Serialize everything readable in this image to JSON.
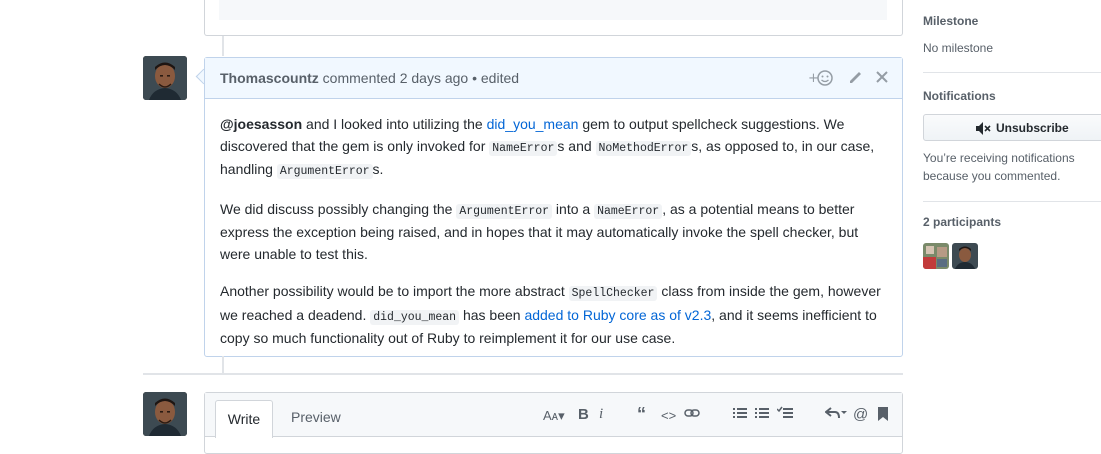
{
  "comment": {
    "author": "Thomascountz",
    "header_rest": "commented 2 days ago • edited",
    "p1": {
      "mention": "@joesasson",
      "t1": " and I looked into utilizing the ",
      "link1": "did_you_mean",
      "t2": " gem to output spellcheck suggestions. We discovered that the gem is only invoked for ",
      "c1": "NameError",
      "t3": "s and ",
      "c2": "NoMethodError",
      "t4": "s, as opposed to, in our case, handling ",
      "c3": "ArgumentError",
      "t5": "s."
    },
    "p2": {
      "t1": "We did discuss possibly changing the ",
      "c1": "ArgumentError",
      "t2": " into a ",
      "c2": "NameError",
      "t3": ", as a potential means to better express the exception being raised, and in hopes that it may automatically invoke the spell checker, but were unable to test this."
    },
    "p3": {
      "t1": "Another possibility would be to import the more abstract ",
      "c1": "SpellChecker",
      "t2": " class from inside the gem, however we reached a deadend. ",
      "c2": "did_you_mean",
      "t3": " has been ",
      "link1": "added to Ruby core as of v2.3",
      "t4": ", and it seems inefficient to copy so much functionality out of Ruby to reimplement it for our use case."
    }
  },
  "composer": {
    "tab_write": "Write",
    "tab_preview": "Preview"
  },
  "sidebar": {
    "milestone_heading": "Milestone",
    "milestone_value": "No milestone",
    "notifications_heading": "Notifications",
    "unsubscribe_label": "Unsubscribe",
    "notifications_reason": "You’re receiving notifications because you commented.",
    "participants_heading": "2 participants"
  },
  "icons": {
    "reaction": "add-reaction-icon",
    "edit": "pencil-icon",
    "close": "close-icon",
    "mute": "mute-icon"
  }
}
